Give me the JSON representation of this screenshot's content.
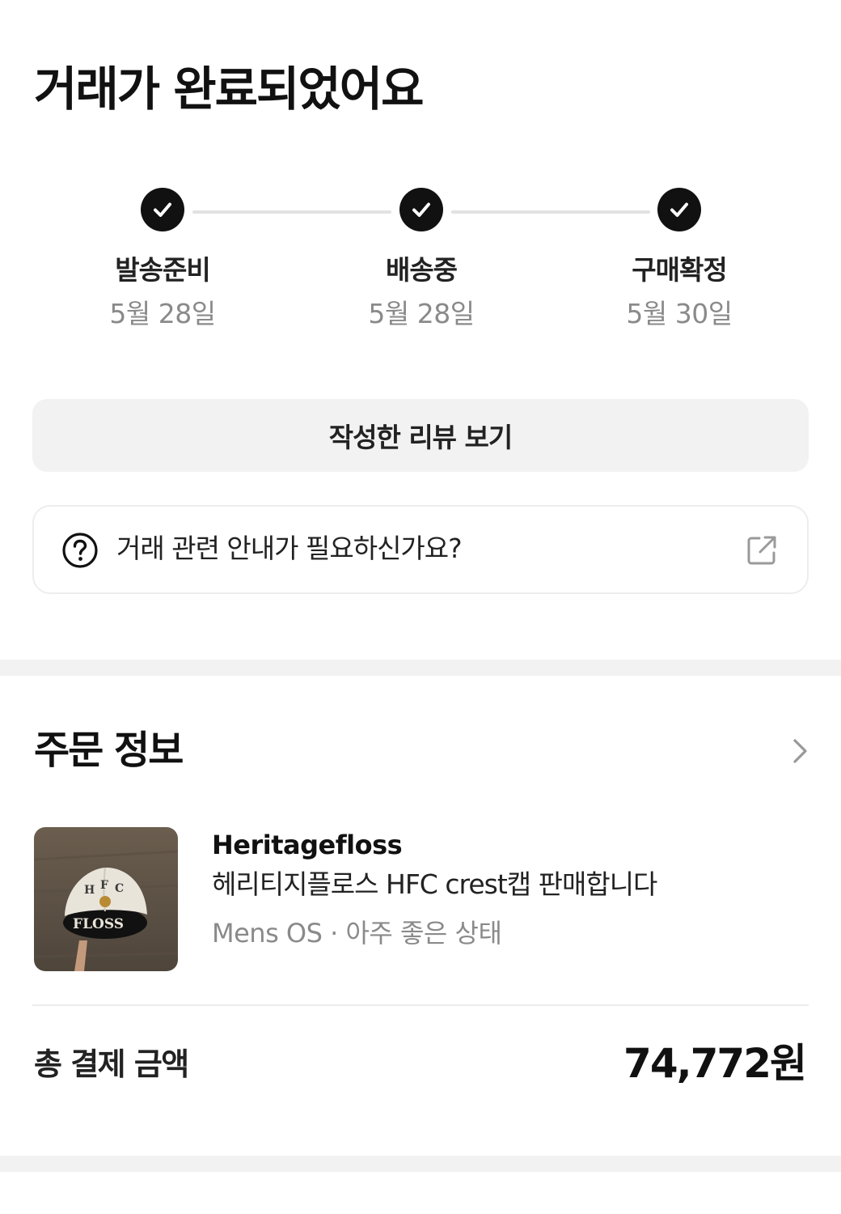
{
  "header": {
    "title": "거래가 완료되었어요"
  },
  "steps": [
    {
      "label": "발송준비",
      "date": "5월 28일",
      "done": true
    },
    {
      "label": "배송중",
      "date": "5월 28일",
      "done": true
    },
    {
      "label": "구매확정",
      "date": "5월 30일",
      "done": true
    }
  ],
  "actions": {
    "review_label": "작성한 리뷰 보기"
  },
  "guide": {
    "text": "거래 관련 안내가 필요하신가요?"
  },
  "order": {
    "section_title": "주문 정보",
    "product": {
      "brand": "Heritagefloss",
      "name": "헤리티지플로스 HFC crest캡 판매합니다",
      "meta": "Mens OS · 아주 좋은 상태"
    },
    "total_label": "총 결제 금액",
    "total_value": "74,772원"
  },
  "icons": {
    "step": "check-circle-icon",
    "guide": "question-circle-icon",
    "external": "external-link-icon",
    "chevron": "chevron-right-icon"
  },
  "colors": {
    "accent": "#111111",
    "muted": "#8a8a8a",
    "surface": "#f2f2f2"
  }
}
